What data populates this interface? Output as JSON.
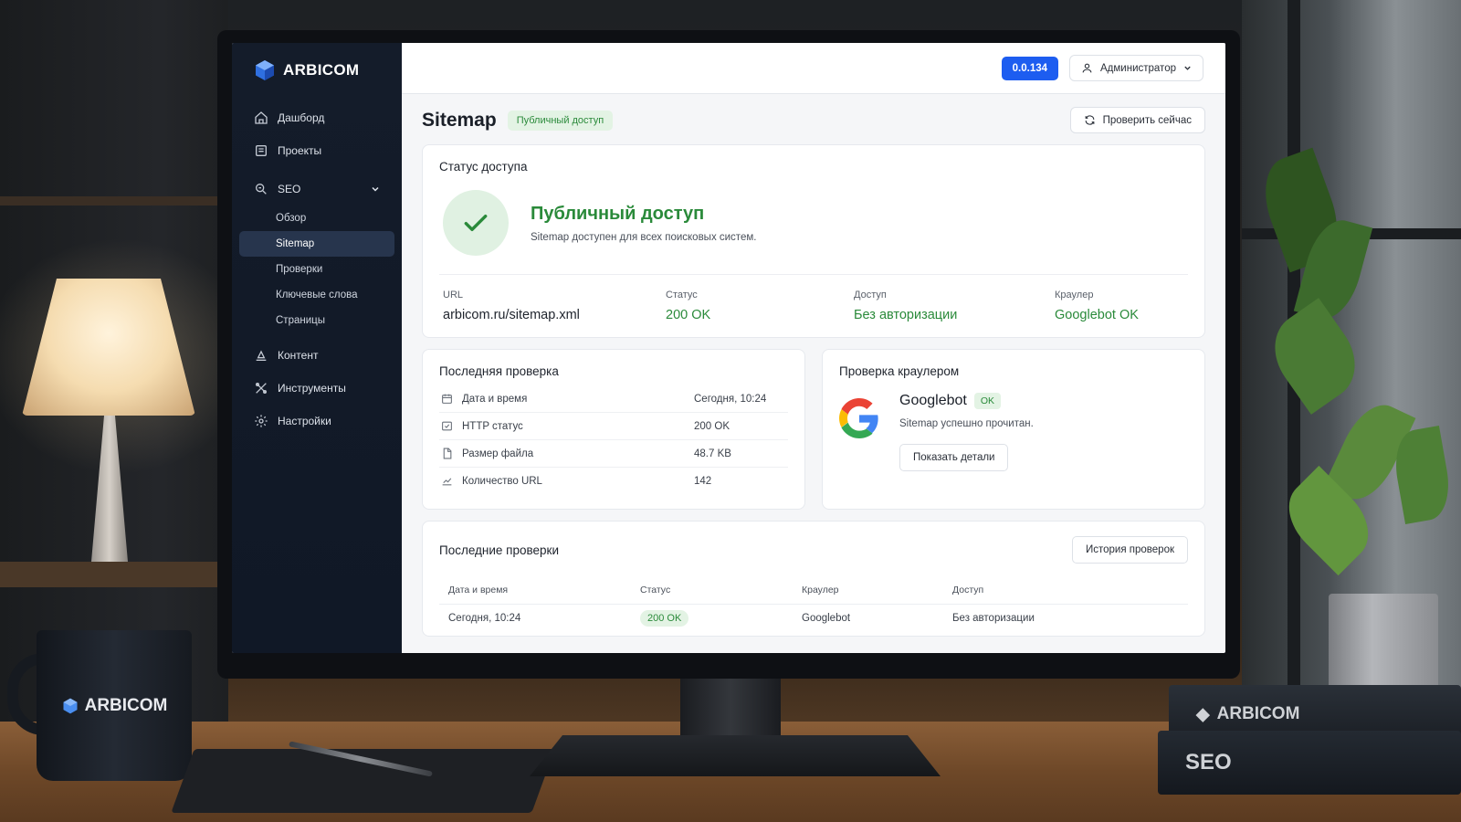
{
  "app": {
    "brand": "ARBICOM",
    "version": "0.0.134",
    "user": "Администратор"
  },
  "sidebar": {
    "items": [
      {
        "label": "Дашборд",
        "icon": "home-icon"
      },
      {
        "label": "Проекты",
        "icon": "projects-icon"
      },
      {
        "label": "SEO",
        "icon": "search-icon",
        "expanded": true
      },
      {
        "label": "Контент",
        "icon": "content-icon"
      },
      {
        "label": "Инструменты",
        "icon": "tools-icon"
      },
      {
        "label": "Настройки",
        "icon": "gear-icon"
      }
    ],
    "seo_sub": [
      "Обзор",
      "Sitemap",
      "Проверки",
      "Ключевые слова",
      "Страницы"
    ],
    "active_sub": "Sitemap"
  },
  "page": {
    "title": "Sitemap",
    "badge": "Публичный доступ",
    "check_now": "Проверить сейчас"
  },
  "access_status": {
    "title": "Статус доступа",
    "hero_title": "Публичный доступ",
    "hero_desc": "Sitemap доступен для всех поисковых систем.",
    "metrics": [
      {
        "label": "URL",
        "value": "arbicom.ru/sitemap.xml",
        "green": false
      },
      {
        "label": "Статус",
        "value": "200 OK",
        "green": true
      },
      {
        "label": "Доступ",
        "value": "Без авторизации",
        "green": true
      },
      {
        "label": "Краулер",
        "value": "Googlebot OK",
        "green": true
      }
    ]
  },
  "last_check": {
    "title": "Последняя проверка",
    "rows": [
      {
        "key": "Дата и время",
        "value": "Сегодня, 10:24",
        "icon": "calendar-icon"
      },
      {
        "key": "HTTP статус",
        "value": "200 OK",
        "icon": "http-status-icon"
      },
      {
        "key": "Размер файла",
        "value": "48.7 KB",
        "icon": "file-icon"
      },
      {
        "key": "Количество URL",
        "value": "142",
        "icon": "chart-line-icon"
      }
    ]
  },
  "crawler_check": {
    "title": "Проверка краулером",
    "name": "Googlebot",
    "status": "OK",
    "desc": "Sitemap успешно прочитан.",
    "details_btn": "Показать детали"
  },
  "recent_checks": {
    "title": "Последние проверки",
    "history_btn": "История проверок",
    "columns": [
      "Дата и время",
      "Статус",
      "Краулер",
      "Доступ"
    ],
    "rows": [
      {
        "date": "Сегодня, 10:24",
        "status": "200 OK",
        "crawler": "Googlebot",
        "access": "Без авторизации"
      }
    ]
  },
  "scene": {
    "mug_brand": "ARBICOM",
    "book1": "ARBICOM",
    "book2": "SEO"
  },
  "colors": {
    "accent": "#1d5df0",
    "success": "#2a8a3a",
    "sidebar": "#141c2a"
  }
}
